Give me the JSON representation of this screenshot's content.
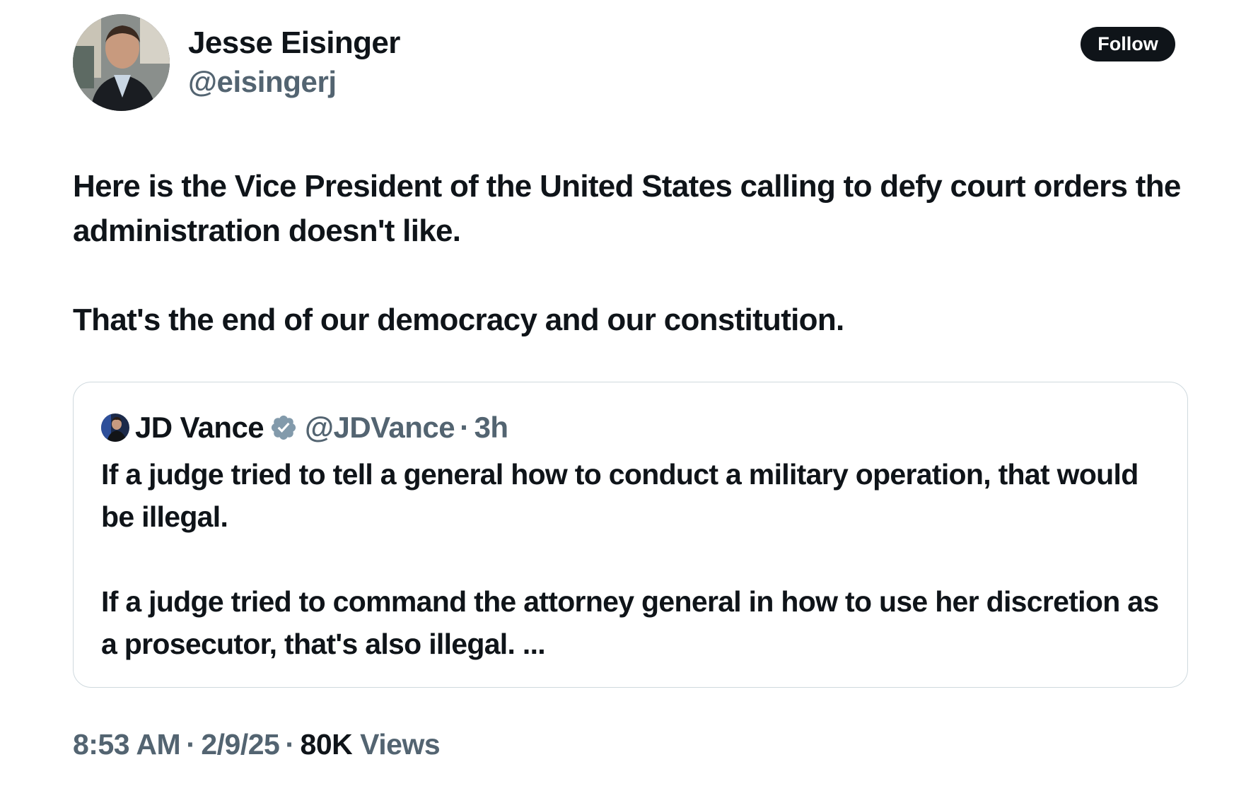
{
  "author": {
    "name": "Jesse Eisinger",
    "handle": "@eisingerj",
    "avatar_icon": "profile-photo"
  },
  "follow_label": "Follow",
  "tweet": {
    "paragraphs": [
      "Here is the Vice President of the United States calling to defy court orders the administration doesn't like.",
      "That's the end of our democracy and our constitution."
    ]
  },
  "quoted": {
    "name": "JD Vance",
    "verified": true,
    "verified_icon": "verified-badge-icon",
    "verified_color": "#829aab",
    "handle": "@JDVance",
    "dot": "·",
    "time": "3h",
    "paragraphs": [
      "If a judge tried to tell a general how to conduct a military operation, that would be illegal.",
      "If a judge tried to command the attorney general in how to use her discretion as a prosecutor, that's also illegal. ..."
    ]
  },
  "meta": {
    "time": "8:53 AM",
    "date": "2/9/25",
    "sep": "·",
    "views_count": "80K",
    "views_label": "Views"
  },
  "colors": {
    "text_primary": "#0f1419",
    "text_secondary": "#536471",
    "border": "#cfd9de",
    "button_bg": "#0f1419",
    "button_text": "#ffffff"
  }
}
